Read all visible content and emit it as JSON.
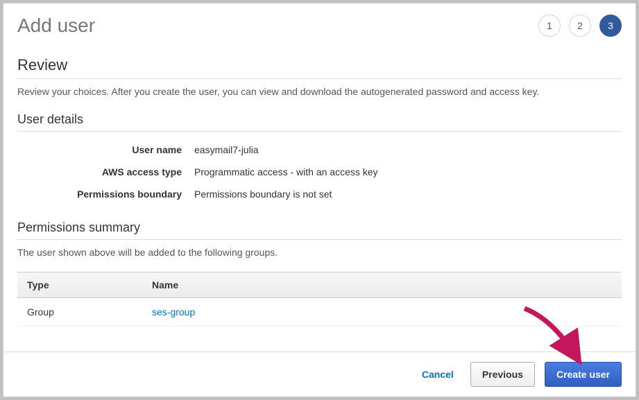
{
  "header": {
    "title": "Add user",
    "steps": [
      "1",
      "2",
      "3"
    ],
    "activeStep": "3"
  },
  "review": {
    "title": "Review",
    "description": "Review your choices. After you create the user, you can view and download the autogenerated password and access key."
  },
  "userDetails": {
    "title": "User details",
    "rows": {
      "username": {
        "label": "User name",
        "value": "easymail7-julia"
      },
      "accessType": {
        "label": "AWS access type",
        "value": "Programmatic access - with an access key"
      },
      "permBoundary": {
        "label": "Permissions boundary",
        "value": "Permissions boundary is not set"
      }
    }
  },
  "permSummary": {
    "title": "Permissions summary",
    "description": "The user shown above will be added to the following groups.",
    "columns": {
      "type": "Type",
      "name": "Name"
    },
    "rows": [
      {
        "type": "Group",
        "name": "ses-group"
      }
    ]
  },
  "footer": {
    "cancel": "Cancel",
    "previous": "Previous",
    "create": "Create user"
  }
}
